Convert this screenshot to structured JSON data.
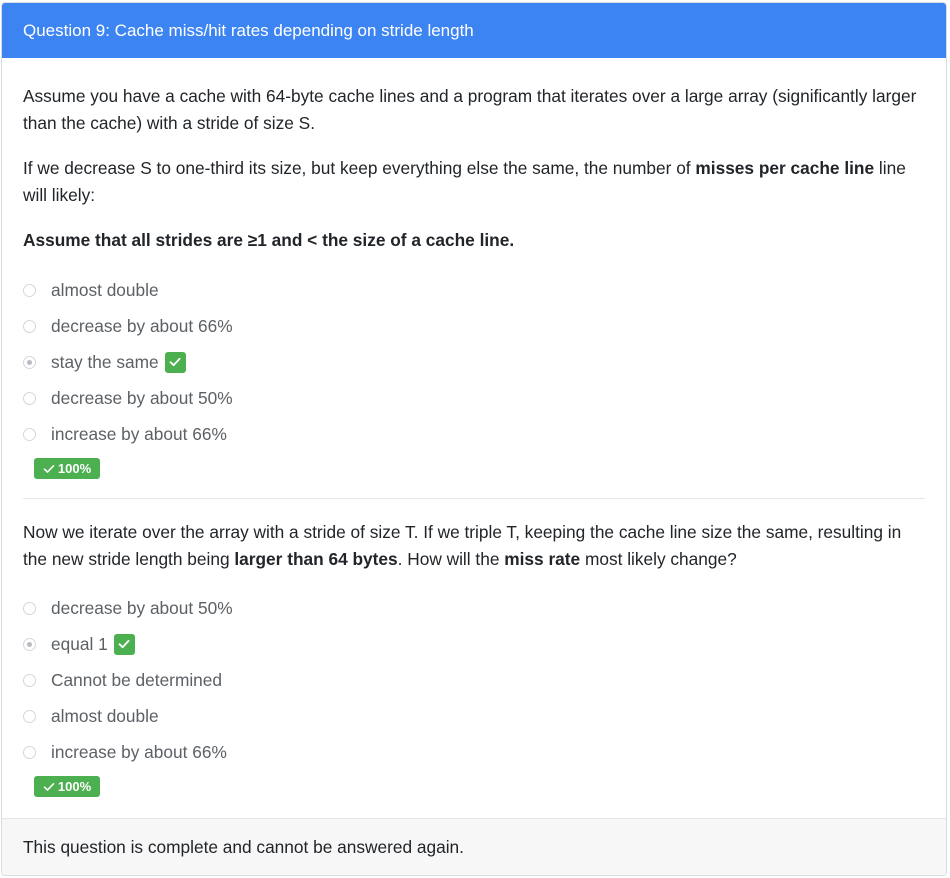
{
  "question": {
    "title": "Question 9: Cache miss/hit rates depending on stride length"
  },
  "part1": {
    "intro": "Assume you have a cache with 64-byte cache lines and a program that iterates over a large array (significantly larger than the cache) with a stride of size S.",
    "prompt_pre": "If we decrease S to one-third its size, but keep everything else the same, the number of ",
    "prompt_bold": "misses per cache line",
    "prompt_post": " line will likely:",
    "assumption": "Assume that all strides are ≥1 and < the size of a cache line.",
    "options": [
      {
        "label": "almost double",
        "selected": false,
        "correct": false
      },
      {
        "label": "decrease by about 66%",
        "selected": false,
        "correct": false
      },
      {
        "label": "stay the same",
        "selected": true,
        "correct": true
      },
      {
        "label": "decrease by about 50%",
        "selected": false,
        "correct": false
      },
      {
        "label": "increase by about 66%",
        "selected": false,
        "correct": false
      }
    ],
    "score": "100%"
  },
  "part2": {
    "prompt_pre": "Now we iterate over the array with a stride of size T. If we triple T, keeping the cache line size the same, resulting in the new stride length being ",
    "prompt_bold1": "larger than 64 bytes",
    "prompt_mid": ". How will the ",
    "prompt_bold2": "miss rate",
    "prompt_post": " most likely change?",
    "options": [
      {
        "label": "decrease by about 50%",
        "selected": false,
        "correct": false
      },
      {
        "label": "equal 1",
        "selected": true,
        "correct": true
      },
      {
        "label": "Cannot be determined",
        "selected": false,
        "correct": false
      },
      {
        "label": "almost double",
        "selected": false,
        "correct": false
      },
      {
        "label": "increase by about 66%",
        "selected": false,
        "correct": false
      }
    ],
    "score": "100%"
  },
  "footer": {
    "text": "This question is complete and cannot be answered again."
  },
  "colors": {
    "header": "#3d84f3",
    "success": "#4caf50"
  }
}
